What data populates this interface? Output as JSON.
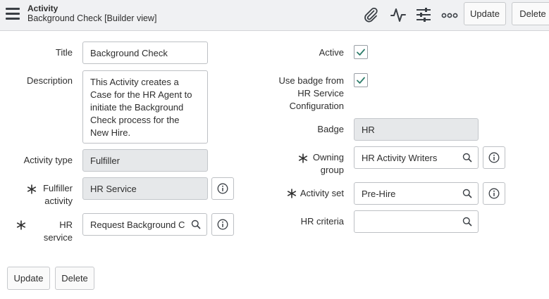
{
  "header": {
    "title": "Activity",
    "subtitle": "Background Check [Builder view]",
    "icons": [
      "paperclip-icon",
      "activity-pulse-icon",
      "sliders-icon",
      "more-options-icon"
    ],
    "update_label": "Update",
    "delete_label": "Delete"
  },
  "form": {
    "title": {
      "label": "Title",
      "value": "Background Check"
    },
    "description": {
      "label": "Description",
      "value": "This Activity creates a Case for the HR Agent to initiate the Background Check process for the New Hire."
    },
    "activity_type": {
      "label": "Activity type",
      "value": "Fulfiller"
    },
    "fulfiller_activity": {
      "label_line1": "Fulfiller",
      "label_line2": "activity",
      "value": "HR Service",
      "required": true
    },
    "hr_service": {
      "label": "HR service",
      "value": "Request Background Check",
      "required": true
    },
    "active": {
      "label": "Active",
      "checked": true
    },
    "use_badge": {
      "label_line1": "Use badge from",
      "label_line2": "HR Service",
      "label_line3": "Configuration",
      "checked": true
    },
    "badge": {
      "label": "Badge",
      "value": "HR"
    },
    "owning_group": {
      "label_line1": "Owning",
      "label_line2": "group",
      "value": "HR Activity Writers",
      "required": true
    },
    "activity_set": {
      "label": "Activity set",
      "value": "Pre-Hire",
      "required": true
    },
    "hr_criteria": {
      "label": "HR criteria",
      "value": ""
    }
  },
  "footer": {
    "update_label": "Update",
    "delete_label": "Delete"
  },
  "colors": {
    "header_bg": "#f0f1f3",
    "readonly_bg": "#e6e8ea",
    "checkmark": "#2e7d6b",
    "border": "#bdc0c4"
  }
}
